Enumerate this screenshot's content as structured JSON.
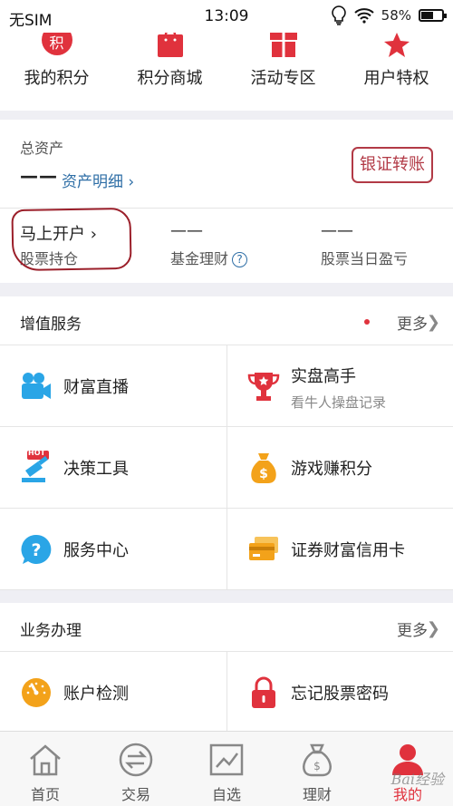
{
  "status_bar": {
    "carrier": "无SIM",
    "time": "13:09",
    "battery": "58%",
    "battery_level": 0.58
  },
  "top_row": {
    "items": [
      {
        "label": "我的积分",
        "icon": "points-icon",
        "glyph": "积"
      },
      {
        "label": "积分商城",
        "icon": "shopping-bag-icon"
      },
      {
        "label": "活动专区",
        "icon": "gift-icon"
      },
      {
        "label": "用户特权",
        "icon": "crown-icon"
      }
    ],
    "page_count": 2,
    "current_page": 1
  },
  "assets": {
    "title": "总资产",
    "total_value": "——",
    "detail_link": "资产明细 ›",
    "transfer_button": "银证转账",
    "cells": [
      {
        "value": "马上开户 ›",
        "label": "股票持仓"
      },
      {
        "value": "——",
        "label": "基金理财"
      },
      {
        "value": "——",
        "label": "股票当日盈亏"
      }
    ],
    "help_glyph": "?"
  },
  "value_added": {
    "title": "增值服务",
    "more": "更多",
    "items": [
      {
        "label": "财富直播",
        "icon": "video-camera-icon"
      },
      {
        "label": "实盘高手",
        "sublabel": "看牛人操盘记录",
        "icon": "trophy-icon"
      },
      {
        "label": "决策工具",
        "icon": "hot-tools-icon",
        "badge": "HOT"
      },
      {
        "label": "游戏赚积分",
        "icon": "money-bag-icon"
      },
      {
        "label": "服务中心",
        "icon": "help-circle-icon"
      },
      {
        "label": "证券财富信用卡",
        "icon": "credit-card-icon"
      }
    ]
  },
  "business": {
    "title": "业务办理",
    "more": "更多",
    "items": [
      {
        "label": "账户检测",
        "icon": "gauge-icon"
      },
      {
        "label": "忘记股票密码",
        "icon": "lock-icon"
      }
    ]
  },
  "bottom_nav": {
    "items": [
      {
        "label": "首页",
        "icon": "home-icon"
      },
      {
        "label": "交易",
        "icon": "trade-icon"
      },
      {
        "label": "自选",
        "icon": "chart-icon"
      },
      {
        "label": "理财",
        "icon": "finance-bag-icon"
      },
      {
        "label": "我的",
        "icon": "user-icon",
        "active": true
      }
    ]
  },
  "watermark": "Bai经验",
  "colors": {
    "accent_red": "#e0323d",
    "link_blue": "#2e6ea6",
    "orange": "#f3a21a",
    "blue": "#2aa5e6"
  }
}
